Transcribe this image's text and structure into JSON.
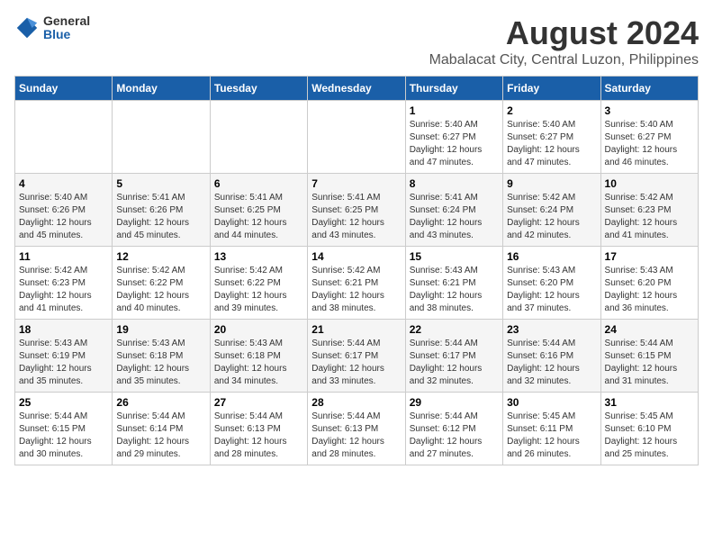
{
  "logo": {
    "general": "General",
    "blue": "Blue"
  },
  "title": "August 2024",
  "subtitle": "Mabalacat City, Central Luzon, Philippines",
  "days_of_week": [
    "Sunday",
    "Monday",
    "Tuesday",
    "Wednesday",
    "Thursday",
    "Friday",
    "Saturday"
  ],
  "weeks": [
    [
      {
        "day": "",
        "info": ""
      },
      {
        "day": "",
        "info": ""
      },
      {
        "day": "",
        "info": ""
      },
      {
        "day": "",
        "info": ""
      },
      {
        "day": "1",
        "info": "Sunrise: 5:40 AM\nSunset: 6:27 PM\nDaylight: 12 hours\nand 47 minutes."
      },
      {
        "day": "2",
        "info": "Sunrise: 5:40 AM\nSunset: 6:27 PM\nDaylight: 12 hours\nand 47 minutes."
      },
      {
        "day": "3",
        "info": "Sunrise: 5:40 AM\nSunset: 6:27 PM\nDaylight: 12 hours\nand 46 minutes."
      }
    ],
    [
      {
        "day": "4",
        "info": "Sunrise: 5:40 AM\nSunset: 6:26 PM\nDaylight: 12 hours\nand 45 minutes."
      },
      {
        "day": "5",
        "info": "Sunrise: 5:41 AM\nSunset: 6:26 PM\nDaylight: 12 hours\nand 45 minutes."
      },
      {
        "day": "6",
        "info": "Sunrise: 5:41 AM\nSunset: 6:25 PM\nDaylight: 12 hours\nand 44 minutes."
      },
      {
        "day": "7",
        "info": "Sunrise: 5:41 AM\nSunset: 6:25 PM\nDaylight: 12 hours\nand 43 minutes."
      },
      {
        "day": "8",
        "info": "Sunrise: 5:41 AM\nSunset: 6:24 PM\nDaylight: 12 hours\nand 43 minutes."
      },
      {
        "day": "9",
        "info": "Sunrise: 5:42 AM\nSunset: 6:24 PM\nDaylight: 12 hours\nand 42 minutes."
      },
      {
        "day": "10",
        "info": "Sunrise: 5:42 AM\nSunset: 6:23 PM\nDaylight: 12 hours\nand 41 minutes."
      }
    ],
    [
      {
        "day": "11",
        "info": "Sunrise: 5:42 AM\nSunset: 6:23 PM\nDaylight: 12 hours\nand 41 minutes."
      },
      {
        "day": "12",
        "info": "Sunrise: 5:42 AM\nSunset: 6:22 PM\nDaylight: 12 hours\nand 40 minutes."
      },
      {
        "day": "13",
        "info": "Sunrise: 5:42 AM\nSunset: 6:22 PM\nDaylight: 12 hours\nand 39 minutes."
      },
      {
        "day": "14",
        "info": "Sunrise: 5:42 AM\nSunset: 6:21 PM\nDaylight: 12 hours\nand 38 minutes."
      },
      {
        "day": "15",
        "info": "Sunrise: 5:43 AM\nSunset: 6:21 PM\nDaylight: 12 hours\nand 38 minutes."
      },
      {
        "day": "16",
        "info": "Sunrise: 5:43 AM\nSunset: 6:20 PM\nDaylight: 12 hours\nand 37 minutes."
      },
      {
        "day": "17",
        "info": "Sunrise: 5:43 AM\nSunset: 6:20 PM\nDaylight: 12 hours\nand 36 minutes."
      }
    ],
    [
      {
        "day": "18",
        "info": "Sunrise: 5:43 AM\nSunset: 6:19 PM\nDaylight: 12 hours\nand 35 minutes."
      },
      {
        "day": "19",
        "info": "Sunrise: 5:43 AM\nSunset: 6:18 PM\nDaylight: 12 hours\nand 35 minutes."
      },
      {
        "day": "20",
        "info": "Sunrise: 5:43 AM\nSunset: 6:18 PM\nDaylight: 12 hours\nand 34 minutes."
      },
      {
        "day": "21",
        "info": "Sunrise: 5:44 AM\nSunset: 6:17 PM\nDaylight: 12 hours\nand 33 minutes."
      },
      {
        "day": "22",
        "info": "Sunrise: 5:44 AM\nSunset: 6:17 PM\nDaylight: 12 hours\nand 32 minutes."
      },
      {
        "day": "23",
        "info": "Sunrise: 5:44 AM\nSunset: 6:16 PM\nDaylight: 12 hours\nand 32 minutes."
      },
      {
        "day": "24",
        "info": "Sunrise: 5:44 AM\nSunset: 6:15 PM\nDaylight: 12 hours\nand 31 minutes."
      }
    ],
    [
      {
        "day": "25",
        "info": "Sunrise: 5:44 AM\nSunset: 6:15 PM\nDaylight: 12 hours\nand 30 minutes."
      },
      {
        "day": "26",
        "info": "Sunrise: 5:44 AM\nSunset: 6:14 PM\nDaylight: 12 hours\nand 29 minutes."
      },
      {
        "day": "27",
        "info": "Sunrise: 5:44 AM\nSunset: 6:13 PM\nDaylight: 12 hours\nand 28 minutes."
      },
      {
        "day": "28",
        "info": "Sunrise: 5:44 AM\nSunset: 6:13 PM\nDaylight: 12 hours\nand 28 minutes."
      },
      {
        "day": "29",
        "info": "Sunrise: 5:44 AM\nSunset: 6:12 PM\nDaylight: 12 hours\nand 27 minutes."
      },
      {
        "day": "30",
        "info": "Sunrise: 5:45 AM\nSunset: 6:11 PM\nDaylight: 12 hours\nand 26 minutes."
      },
      {
        "day": "31",
        "info": "Sunrise: 5:45 AM\nSunset: 6:10 PM\nDaylight: 12 hours\nand 25 minutes."
      }
    ]
  ]
}
